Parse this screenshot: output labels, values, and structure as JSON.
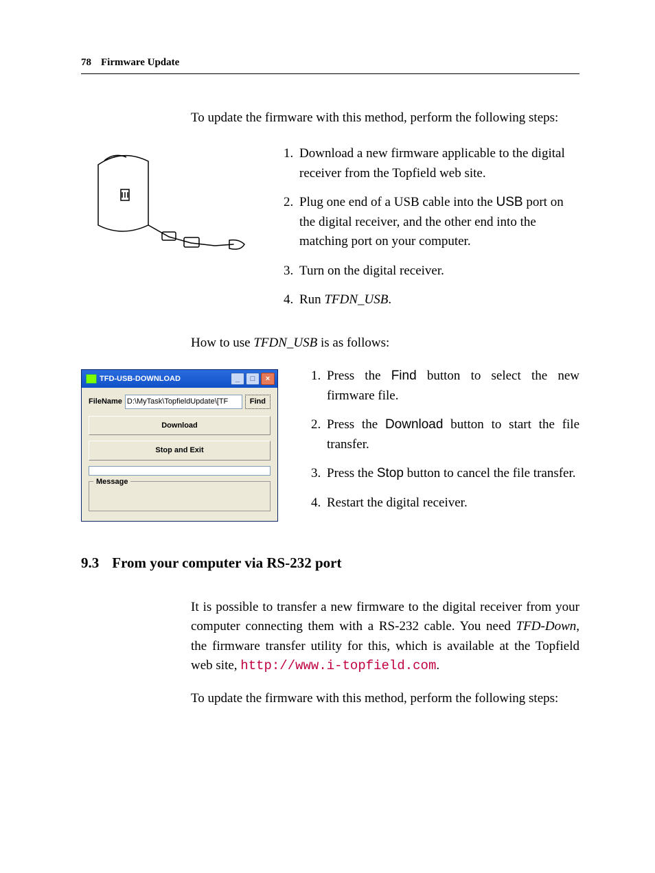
{
  "header": {
    "page_number": "78",
    "chapter_title": "Firmware Update"
  },
  "intro": "To update the firmware with this method, perform the following steps:",
  "first_steps": {
    "s1": "Download a new firmware applicable to the digital receiver from the Topfield web site.",
    "s2a": "Plug one end of a USB cable into the ",
    "s2_usb": "USB",
    "s2b": " port on the digital receiver, and the other end into the matching port on your computer.",
    "s3": "Turn on the digital receiver.",
    "s4a": "Run ",
    "s4_prog": "TFDN_USB",
    "s4b": "."
  },
  "howto": {
    "pre": "How to use ",
    "prog": "TFDN_USB",
    "post": " is as follows:"
  },
  "tfd_window": {
    "title": "TFD-USB-DOWNLOAD",
    "filename_label": "FileName",
    "filename_value": "D:\\MyTask\\TopfieldUpdate\\[TF",
    "find_btn": "Find",
    "download_btn": "Download",
    "stop_btn": "Stop and Exit",
    "message_label": "Message"
  },
  "second_steps": {
    "s1a": "Press the ",
    "s1_btn": "Find",
    "s1b": " button to select the new firmware file.",
    "s2a": "Press the ",
    "s2_btn": "Download",
    "s2b": " button to start the file transfer.",
    "s3a": "Press the ",
    "s3_btn": "Stop",
    "s3b": " button to cancel the file transfer.",
    "s4": "Restart the digital receiver."
  },
  "section": {
    "number": "9.3",
    "title": "From your computer via RS-232 port"
  },
  "rs232": {
    "p1a": "It is possible to transfer a new firmware to the digital receiver from your computer connecting them with a RS-232 cable. You need ",
    "p1_prog": "TFD-Down",
    "p1b": ", the firmware transfer utility for this, which is available at the Topfield web site, ",
    "p1_url": "http://www.i-topfield.com",
    "p1c": ".",
    "p2": "To update the firmware with this method, perform the following steps:"
  }
}
